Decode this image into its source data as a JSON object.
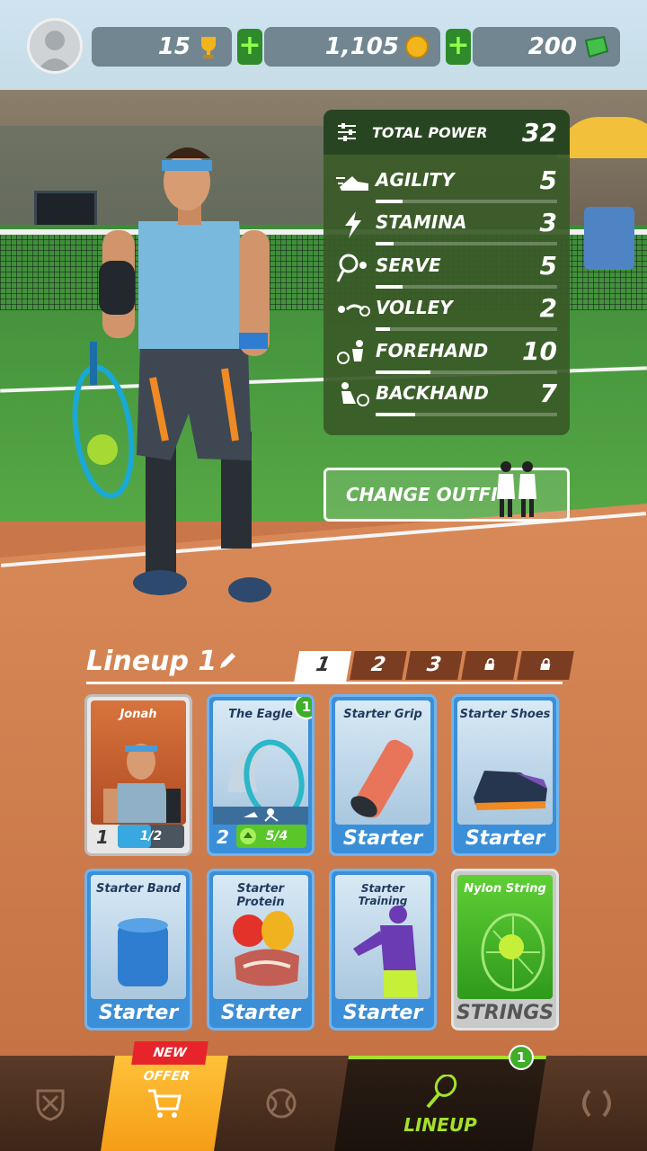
{
  "topbar": {
    "trophies": "15",
    "coins": "1,105",
    "gems": "200"
  },
  "stats": {
    "total_label": "TOTAL POWER",
    "total_value": "32",
    "items": [
      {
        "name": "AGILITY",
        "value": "5",
        "level": 0.15,
        "icon": "running-shoe-icon"
      },
      {
        "name": "STAMINA",
        "value": "3",
        "level": 0.1,
        "icon": "lightning-icon"
      },
      {
        "name": "SERVE",
        "value": "5",
        "level": 0.15,
        "icon": "serve-racket-icon"
      },
      {
        "name": "VOLLEY",
        "value": "2",
        "level": 0.08,
        "icon": "volley-icon"
      },
      {
        "name": "FOREHAND",
        "value": "10",
        "level": 0.3,
        "icon": "forehand-icon"
      },
      {
        "name": "BACKHAND",
        "value": "7",
        "level": 0.22,
        "icon": "backhand-icon"
      }
    ]
  },
  "change_outfit": "CHANGE OUTFIT",
  "lineup": {
    "title": "Lineup 1",
    "tabs": [
      "1",
      "2",
      "3"
    ],
    "active_tab": "1",
    "cards": [
      {
        "title": "Jonah",
        "level": "1",
        "progress": "1/2"
      },
      {
        "title": "The Eagle",
        "level": "2",
        "progress": "5/4",
        "badge": "1"
      },
      {
        "title": "Starter Grip",
        "bottom": "Starter"
      },
      {
        "title": "Starter Shoes",
        "bottom": "Starter"
      },
      {
        "title": "Starter Band",
        "bottom": "Starter"
      },
      {
        "title": "Starter Protein",
        "bottom": "Starter"
      },
      {
        "title": "Starter Training",
        "bottom": "Starter"
      },
      {
        "title": "Nylon String",
        "bottom": "STRINGS"
      }
    ]
  },
  "nav": {
    "new_offer": "NEW OFFER",
    "lineup_label": "LINEUP",
    "lineup_badge": "1"
  },
  "colors": {
    "stat_panel": "#3a5a28",
    "card_blue": "#3b8fd8",
    "accent_green": "#a4e12b",
    "shop_orange": "#f5a51c"
  }
}
